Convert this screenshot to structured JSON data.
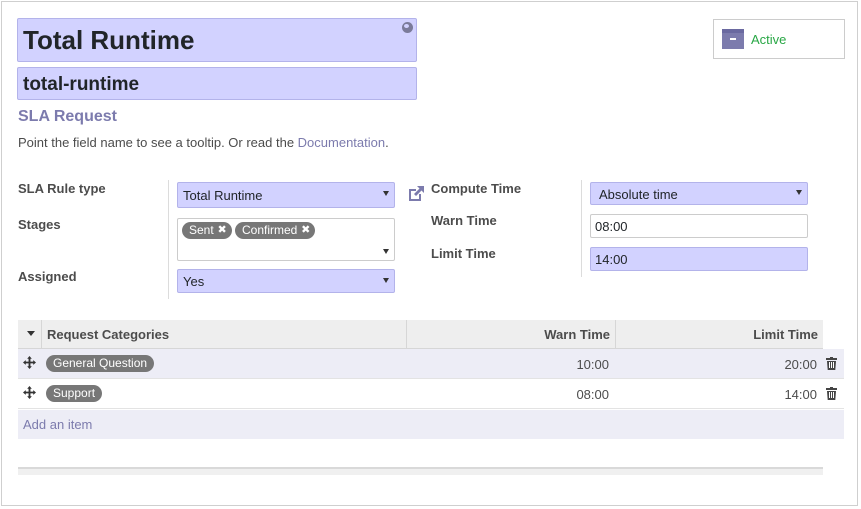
{
  "header": {
    "name": "Total Runtime",
    "code": "total-runtime",
    "subtitle": "SLA Request",
    "help_prefix": "Point the field name to see a tooltip. Or read the ",
    "help_link": "Documentation",
    "help_suffix": "."
  },
  "status_button": {
    "label": "Active"
  },
  "fields": {
    "sla_rule_type": {
      "label": "SLA Rule type",
      "value": "Total Runtime"
    },
    "stages": {
      "label": "Stages",
      "tags": [
        "Sent",
        "Confirmed"
      ]
    },
    "assigned": {
      "label": "Assigned",
      "value": "Yes"
    },
    "compute_time": {
      "label": "Compute Time",
      "value": "Absolute time"
    },
    "warn_time": {
      "label": "Warn Time",
      "value": "08:00"
    },
    "limit_time": {
      "label": "Limit Time",
      "value": "14:00"
    }
  },
  "table": {
    "columns": [
      "Request Categories",
      "Warn Time",
      "Limit Time"
    ],
    "rows": [
      {
        "category": "General Question",
        "warn": "10:00",
        "limit": "20:00"
      },
      {
        "category": "Support",
        "warn": "08:00",
        "limit": "14:00"
      }
    ],
    "add_label": "Add an item"
  },
  "colors": {
    "accent": "#7c7bad",
    "required_bg": "#d2d2ff",
    "active_green": "#28a745",
    "tag_bg": "#777777"
  }
}
